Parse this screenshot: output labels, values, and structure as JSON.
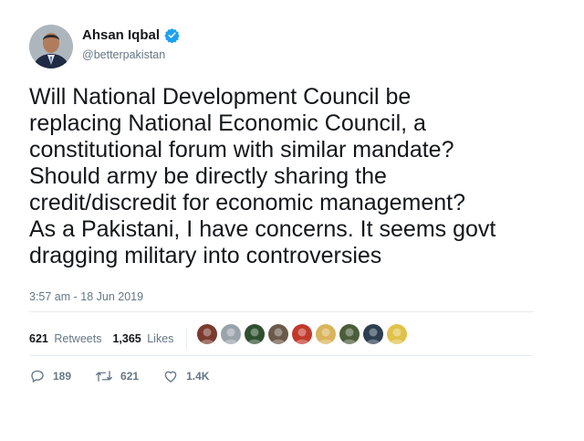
{
  "author": {
    "display_name": "Ahsan Iqbal",
    "handle": "@betterpakistan",
    "verified": true
  },
  "tweet": {
    "lines": [
      "Will National Development Council be",
      "replacing National Economic Council, a",
      "constitutional forum with similar mandate?",
      "Should army be directly sharing the",
      "credit/discredit for economic management?",
      "As a Pakistani, I have concerns. It seems govt",
      "dragging military into controversies"
    ],
    "timestamp": "3:57 am - 18 Jun 2019"
  },
  "stats": {
    "retweets_count": "621",
    "retweets_label": "Retweets",
    "likes_count": "1,365",
    "likes_label": "Likes"
  },
  "actions": {
    "reply_count": "189",
    "retweet_count": "621",
    "like_count": "1.4K"
  },
  "liker_avatars": [
    "#7a3b2e",
    "#9aa3ab",
    "#2f4f2f",
    "#6b5a4a",
    "#c0392b",
    "#d9b45a",
    "#4b5d3a",
    "#2c3e50",
    "#e0c24a"
  ],
  "colors": {
    "verified": "#1da1f2",
    "secondary_text": "#657786",
    "primary_text": "#14171a"
  }
}
